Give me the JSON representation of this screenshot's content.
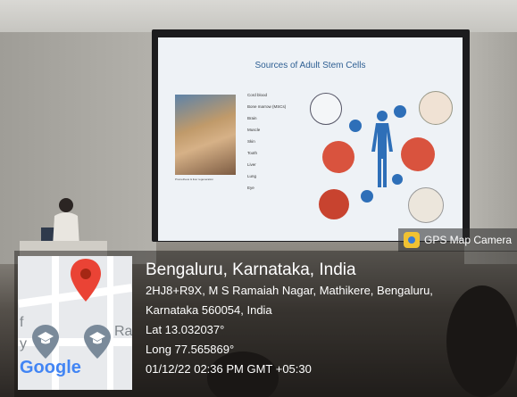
{
  "slide": {
    "title": "Sources of Adult Stem Cells",
    "image_caption": "Prometheus & liver regeneration",
    "cell_sources": [
      "Cord blood",
      "Bone marrow (MSCs)",
      "Brain",
      "Muscle",
      "Skin",
      "Tooth",
      "Liver",
      "Lung",
      "Eye"
    ]
  },
  "badge": {
    "label": "GPS Map Camera",
    "icon": "camera-pin-icon"
  },
  "map": {
    "street_fragments": [
      "f",
      "y",
      "Ra"
    ],
    "brand": "Google",
    "icons": [
      "location-pin-icon",
      "graduation-cap-icon",
      "graduation-cap-icon"
    ]
  },
  "location": {
    "title": "Bengaluru, Karnataka, India",
    "address_line1": "2HJ8+R9X, M S Ramaiah Nagar, Mathikere, Bengaluru,",
    "address_line2": "Karnataka 560054, India",
    "lat": "Lat 13.032037°",
    "long": "Long 77.565869°",
    "datetime": "01/12/22 02:36 PM GMT +05:30"
  },
  "colors": {
    "pin": "#ea4335",
    "slide_title": "#2e5f93",
    "cell_red": "#d9533e",
    "figure_blue": "#2e6fb8"
  }
}
